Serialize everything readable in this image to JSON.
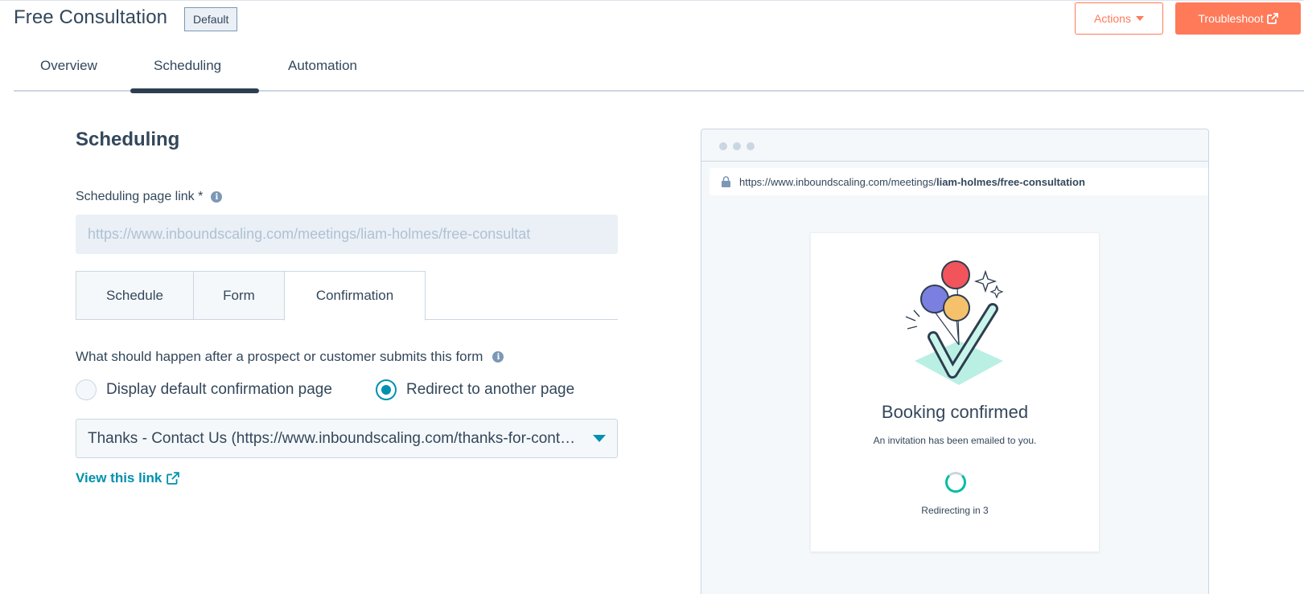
{
  "header": {
    "title": "Free Consultation",
    "badge": "Default",
    "actions_label": "Actions",
    "troubleshoot_label": "Troubleshoot"
  },
  "tabs": [
    {
      "label": "Overview"
    },
    {
      "label": "Scheduling",
      "active": true
    },
    {
      "label": "Automation"
    }
  ],
  "scheduling": {
    "section_title": "Scheduling",
    "link_label": "Scheduling page link *",
    "link_value": "https://www.inboundscaling.com/meetings/liam-holmes/free-consultat",
    "subtabs": [
      {
        "label": "Schedule"
      },
      {
        "label": "Form"
      },
      {
        "label": "Confirmation",
        "active": true
      }
    ],
    "question": "What should happen after a prospect or customer submits this form",
    "radio_default": "Display default confirmation page",
    "radio_redirect": "Redirect to another page",
    "selected_option": "redirect",
    "redirect_select_value": "Thanks - Contact Us (https://www.inboundscaling.com/thanks-for-contacting-us)",
    "view_link": "View this link"
  },
  "preview": {
    "url_prefix": "https://www.inboundscaling.com/meetings/",
    "url_path": "liam-holmes/free-consultation",
    "card_title": "Booking confirmed",
    "card_subtitle": "An invitation has been emailed to you.",
    "redirect_text": "Redirecting in 3"
  },
  "colors": {
    "accent_orange": "#ff7a59",
    "accent_teal": "#0091ae",
    "text_primary": "#33475b"
  },
  "icons": [
    "info-icon",
    "external-link-icon",
    "lock-icon",
    "caret-down-icon",
    "spinner-icon",
    "balloons-check-illustration"
  ]
}
